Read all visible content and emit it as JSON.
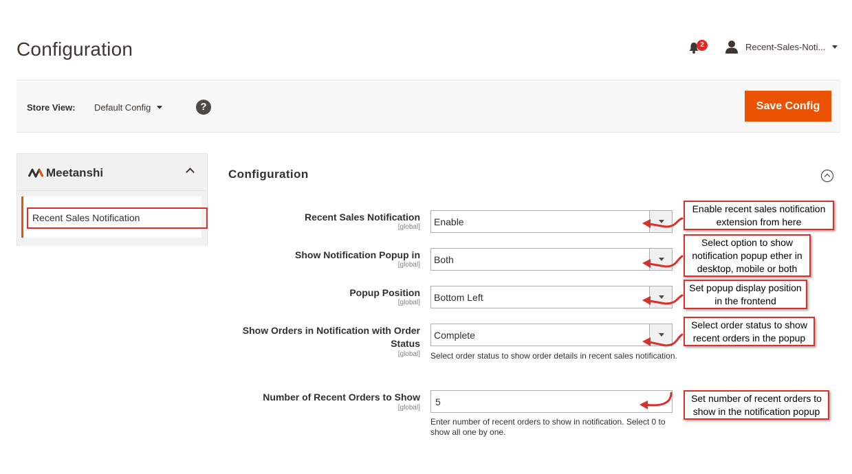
{
  "page": {
    "title": "Configuration"
  },
  "header": {
    "notification_count": "2",
    "user_name": "Recent-Sales-Noti..."
  },
  "store_bar": {
    "label": "Store View:",
    "value": "Default Config",
    "help": "?",
    "save_label": "Save Config"
  },
  "sidebar": {
    "brand": "Meetanshi",
    "items": [
      {
        "label": "Recent Sales Notification"
      }
    ]
  },
  "section": {
    "title": "Configuration",
    "fields": [
      {
        "label": "Recent Sales Notification",
        "scope": "[global]",
        "value": "Enable"
      },
      {
        "label": "Show Notification Popup in",
        "scope": "[global]",
        "value": "Both"
      },
      {
        "label": "Popup Position",
        "scope": "[global]",
        "value": "Bottom Left"
      },
      {
        "label": "Show Orders in Notification with Order Status",
        "scope": "[global]",
        "value": "Complete",
        "note": "Select order status to show order details in recent sales notification."
      },
      {
        "label": "Number of Recent Orders to Show",
        "scope": "[global]",
        "value": "5",
        "note": "Enter number of recent orders to show in notification. Select 0 to show all one by one."
      }
    ]
  },
  "callouts": [
    "Enable recent sales notification extension from here",
    "Select option to show notification popup ether in desktop, mobile or both",
    "Set popup display position in the frontend",
    "Select order status to show recent orders in the popup",
    "Set number of recent orders to show in the notification popup"
  ],
  "colors": {
    "accent": "#eb5202",
    "annotation": "#d9302a",
    "badge": "#e22626"
  }
}
